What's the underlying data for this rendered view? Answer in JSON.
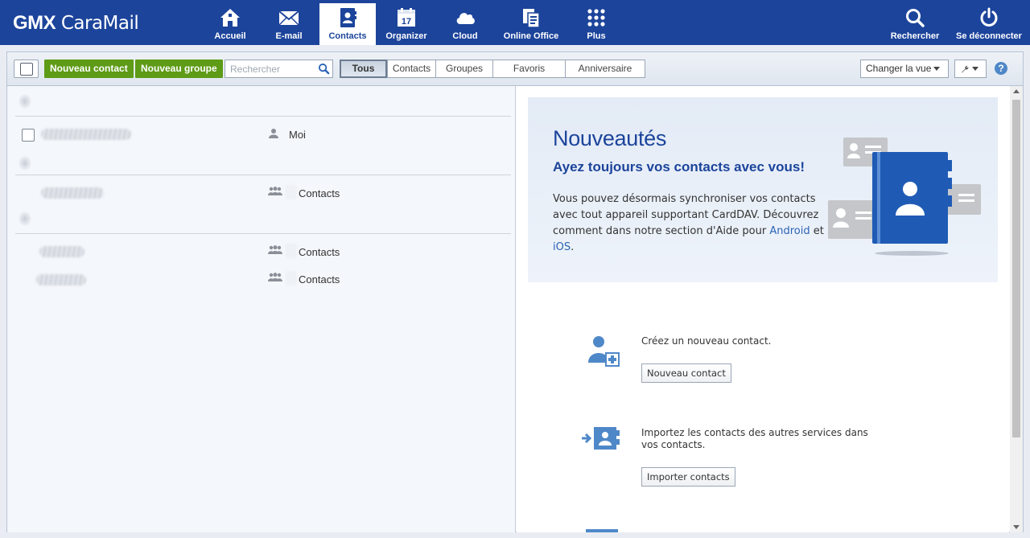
{
  "app": {
    "logo_brand": "GMX",
    "logo_product": "CaraMail"
  },
  "nav": {
    "items": [
      {
        "label": "Accueil",
        "icon": "home-icon"
      },
      {
        "label": "E-mail",
        "icon": "envelope-icon"
      },
      {
        "label": "Contacts",
        "icon": "address-book-icon",
        "active": true
      },
      {
        "label": "Organizer",
        "icon": "calendar-icon",
        "calendar_day": "17"
      },
      {
        "label": "Cloud",
        "icon": "cloud-icon"
      },
      {
        "label": "Online Office",
        "icon": "documents-icon"
      },
      {
        "label": "Plus",
        "icon": "apps-grid-icon"
      }
    ],
    "right_items": [
      {
        "label": "Rechercher",
        "icon": "search-icon"
      },
      {
        "label": "Se déconnecter",
        "icon": "power-icon"
      }
    ]
  },
  "toolbar": {
    "new_contact": "Nouveau contact",
    "new_group": "Nouveau groupe",
    "search_placeholder": "Rechercher",
    "filters": [
      "Tous",
      "Contacts",
      "Groupes",
      "Favoris",
      "Anniversaire"
    ],
    "active_filter": "Tous",
    "change_view": "Changer la vue",
    "help": "?"
  },
  "contacts": {
    "rows": [
      {
        "kind": "person",
        "label": "Moi"
      },
      {
        "kind": "group",
        "label": "Contacts"
      },
      {
        "kind": "group",
        "label": "Contacts"
      },
      {
        "kind": "group",
        "label": "Contacts"
      }
    ]
  },
  "promo": {
    "title": "Nouveautés",
    "subtitle": "Ayez toujours vos contacts avec vous!",
    "text_before": "Vous pouvez désormais synchroniser vos contacts avec tout appareil supportant CardDAV. Découvrez comment dans notre section d'Aide pour ",
    "link_android": "Android",
    "text_and": " et ",
    "link_ios": "iOS",
    "text_end": "."
  },
  "actions": {
    "create": {
      "text": "Créez un nouveau contact.",
      "button": "Nouveau contact"
    },
    "import": {
      "text": "Importez les contacts des autres services dans vos contacts.",
      "button": "Importer contacts"
    }
  },
  "colors": {
    "brand_blue": "#1c449b",
    "green_button": "#5e9b16",
    "link_blue": "#2a63b5"
  }
}
